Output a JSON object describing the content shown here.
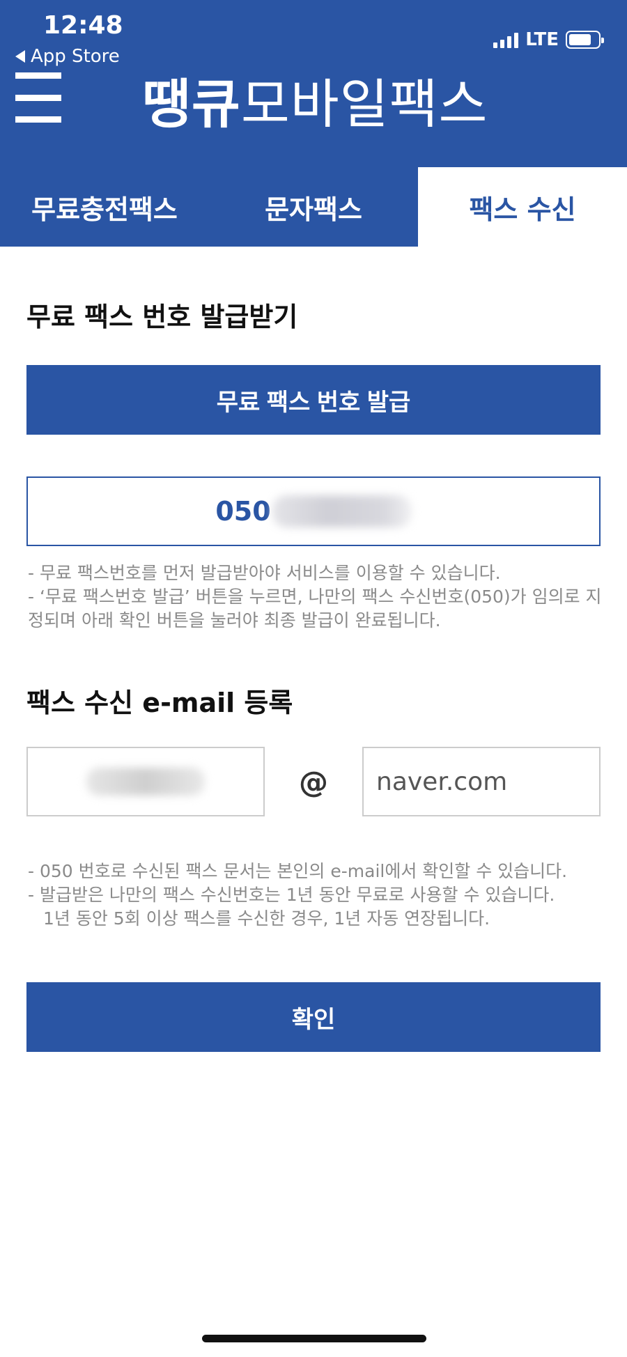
{
  "status_bar": {
    "time": "12:48",
    "back_label": "App Store",
    "network": "LTE"
  },
  "header": {
    "title_bold": "땡큐",
    "title_regular": "모바일팩스"
  },
  "tabs": [
    {
      "label": "무료충전팩스"
    },
    {
      "label": "문자팩스"
    },
    {
      "label": "팩스 수신"
    }
  ],
  "issue_section": {
    "title": "무료 팩스 번호 발급받기",
    "issue_button": "무료 팩스 번호 발급",
    "fax_number_prefix": "050",
    "notes": [
      "- 무료 팩스번호를 먼저 발급받아야 서비스를 이용할 수 있습니다.",
      "- ‘무료 팩스번호 발급’ 버튼을 누르면, 나만의 팩스 수신번호(050)가 임의로 지정되며 아래 확인 버튼을 눌러야 최종 발급이 완료됩니다."
    ]
  },
  "email_section": {
    "title": "팩스 수신 e-mail 등록",
    "at_symbol": "@",
    "domain_value": "naver.com",
    "notes": [
      "- 050 번호로 수신된 팩스 문서는 본인의 e-mail에서 확인할 수 있습니다.",
      "- 발급받은 나만의 팩스 수신번호는 1년 동안 무료로 사용할 수 있습니다.",
      "1년 동안 5회 이상 팩스를 수신한 경우, 1년 자동 연장됩니다."
    ]
  },
  "confirm_button": "확인",
  "colors": {
    "brand_blue": "#2a55a4",
    "note_gray": "#8a8a8a"
  }
}
